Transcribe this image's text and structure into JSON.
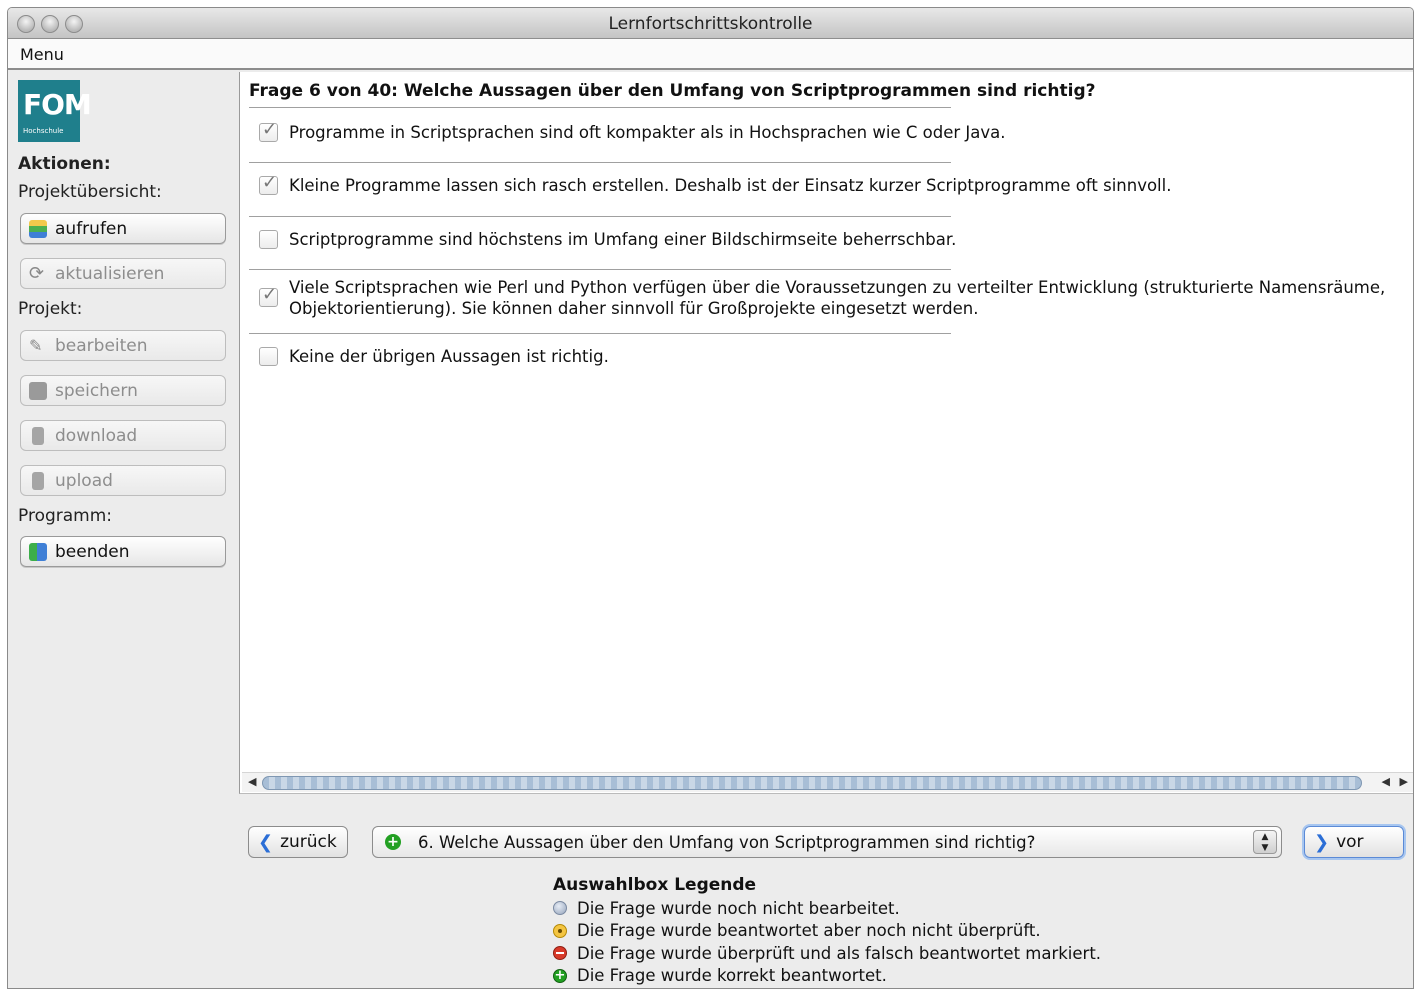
{
  "window": {
    "title": "Lernfortschrittskontrolle"
  },
  "menubar": {
    "menu": "Menu"
  },
  "sidebar": {
    "logo_text": "FOM",
    "logo_sub": "Hochschule",
    "aktionen": "Aktionen:",
    "projektuebersicht": "Projektübersicht:",
    "aufrufen": "aufrufen",
    "aktualisieren": "aktualisieren",
    "projekt": "Projekt:",
    "bearbeiten": "bearbeiten",
    "speichern": "speichern",
    "download": "download",
    "upload": "upload",
    "programm": "Programm:",
    "beenden": "beenden"
  },
  "question": {
    "title": "Frage 6 von 40: Welche Aussagen über den Umfang von Scriptprogrammen sind richtig?",
    "answers": [
      {
        "text": "Programme in Scriptsprachen sind oft kompakter als in Hochsprachen wie C oder Java.",
        "checked": true
      },
      {
        "text": "Kleine Programme lassen sich rasch erstellen. Deshalb ist der Einsatz kurzer Scriptprogramme oft sinnvoll.",
        "checked": true
      },
      {
        "text": "Scriptprogramme sind höchstens im Umfang einer Bildschirmseite beherrschbar.",
        "checked": false
      },
      {
        "text": "Viele Scriptsprachen wie Perl und Python verfügen über die Voraussetzungen zu verteilter Entwicklung (strukturierte Namensräume, Objektorientierung). Sie können daher sinnvoll für Großprojekte eingesetzt werden.",
        "checked": true
      },
      {
        "text": "Keine der übrigen Aussagen ist richtig.",
        "checked": false
      }
    ]
  },
  "navigation": {
    "back": "zurück",
    "forward": "vor",
    "selected": "6. Welche Aussagen über den Umfang von Scriptprogrammen sind richtig?"
  },
  "legend": {
    "title": "Auswahlbox Legende",
    "not_edited": "Die Frage wurde noch nicht bearbeitet.",
    "answered": "Die Frage wurde beantwortet aber noch nicht überprüft.",
    "wrong": "Die Frage wurde überprüft und als falsch beantwortet markiert.",
    "correct": "Die Frage wurde korrekt beantwortet."
  },
  "colors": {
    "logo": "#1f7f8c",
    "correct": "#22a022",
    "wrong": "#d83a2a",
    "answered": "#f4c542",
    "accent": "#2b6ed6"
  }
}
